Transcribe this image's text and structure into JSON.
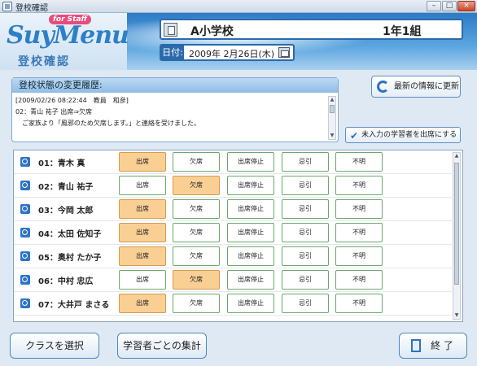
{
  "window": {
    "title": "登校確認"
  },
  "header": {
    "logo_text": "SuyMenu",
    "logo_staff": "for Staff",
    "subtitle": "登校確認",
    "school_name": "A小学校",
    "class_name": "1年1組",
    "date_label": "日付:",
    "date_value": "2009年 2月26日(木)"
  },
  "history": {
    "title": "登校状態の変更履歴:",
    "lines": [
      "[2009/02/26 08:22:44　教員　和彦]",
      "02：青山 祐子 出席⇒欠席",
      "　ご家族より「風邪のため欠席します。」と連絡を受けました。"
    ]
  },
  "buttons": {
    "refresh": "最新の情報に更新",
    "mark_present": "未入力の学習者を出席にする",
    "select_class": "クラスを選択",
    "per_learner": "学習者ごとの集計",
    "exit": "終 了"
  },
  "status_options": [
    "出席",
    "欠席",
    "出席停止",
    "忌引",
    "不明"
  ],
  "students": [
    {
      "name": "01：青木 真",
      "selected": 0
    },
    {
      "name": "02：青山 祐子",
      "selected": 1
    },
    {
      "name": "03：今岡 太郎",
      "selected": 0
    },
    {
      "name": "04：太田 佐知子",
      "selected": 0
    },
    {
      "name": "05：奥村 たか子",
      "selected": 0
    },
    {
      "name": "06：中村 忠広",
      "selected": 1
    },
    {
      "name": "07：大井戸 まさる",
      "selected": 0
    }
  ],
  "colors": {
    "accent": "#2a6aab",
    "selected": "#f9cf94",
    "option_border": "#6ea76e"
  }
}
